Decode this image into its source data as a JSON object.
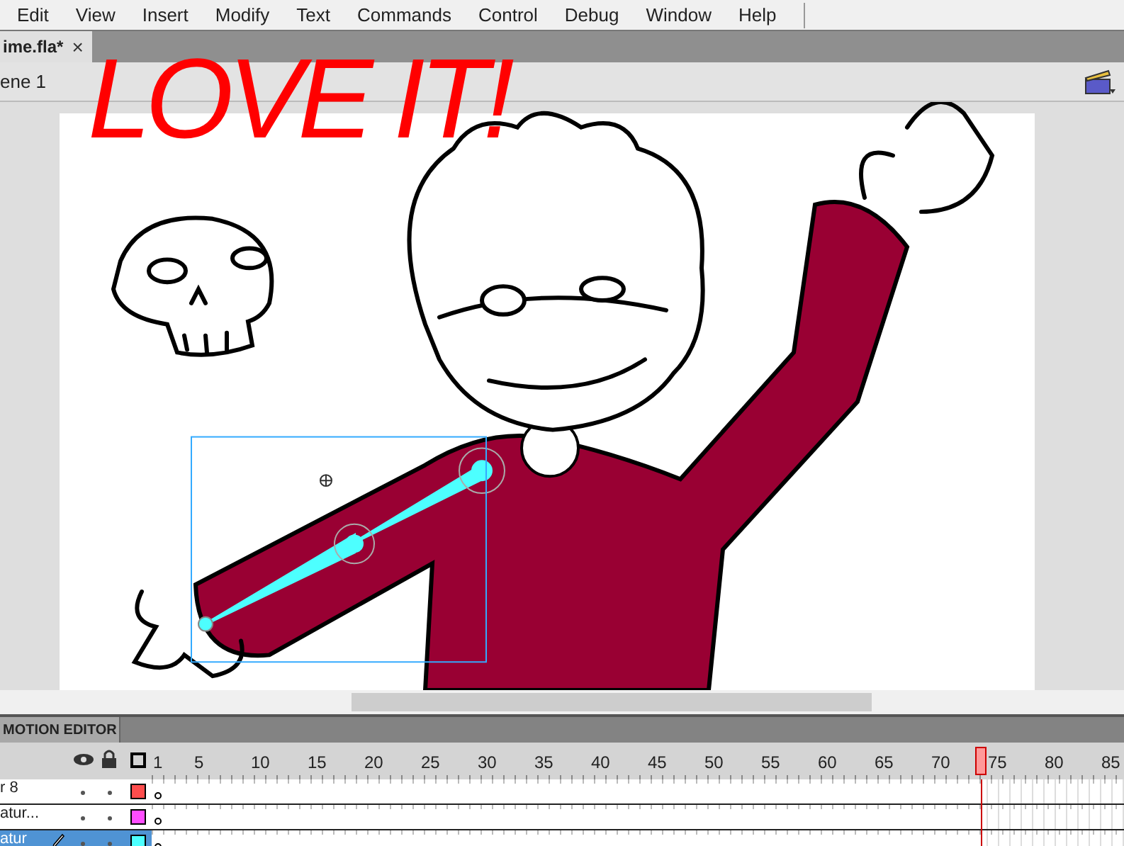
{
  "menu": [
    "Edit",
    "View",
    "Insert",
    "Modify",
    "Text",
    "Commands",
    "Control",
    "Debug",
    "Window",
    "Help"
  ],
  "document_tab": {
    "title": "ime.fla*",
    "close": "×"
  },
  "scene": {
    "label": "ene 1"
  },
  "stage": {
    "annotation": "LOVE IT!"
  },
  "panel": {
    "tab": "MOTION EDITOR"
  },
  "timeline": {
    "frame_numbers": [
      "1",
      "5",
      "10",
      "15",
      "20",
      "25",
      "30",
      "35",
      "40",
      "45",
      "50",
      "55",
      "60",
      "65",
      "70",
      "75",
      "80",
      "85"
    ],
    "playhead": {
      "level": 0.853
    },
    "layers": [
      {
        "name": "r 8",
        "color": "#ff4d4d",
        "selected": false
      },
      {
        "name": "atur...",
        "color": "#ff4dff",
        "selected": false
      },
      {
        "name": "atur",
        "color": "#4dffff",
        "selected": true
      }
    ]
  }
}
